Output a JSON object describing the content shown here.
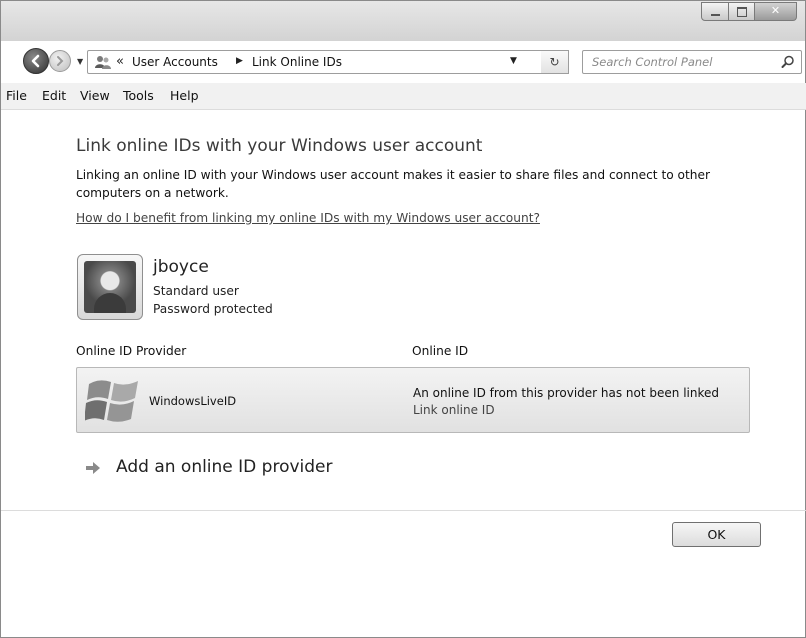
{
  "toolbar": {
    "breadcrumb": [
      "User Accounts",
      "Link Online IDs"
    ],
    "breadcrumb_prefix": "«",
    "search_placeholder": "Search Control Panel"
  },
  "menu": [
    "File",
    "Edit",
    "View",
    "Tools",
    "Help"
  ],
  "page": {
    "heading": "Link online IDs with your Windows user account",
    "description": "Linking an online ID with your Windows user account makes it easier to share files and connect to other computers on a network.",
    "help_link": "How do I benefit from linking my online IDs with my Windows user account?"
  },
  "user": {
    "name": "jboyce",
    "type": "Standard user",
    "protection": "Password protected"
  },
  "columns": {
    "provider": "Online ID Provider",
    "online_id": "Online ID"
  },
  "providers": [
    {
      "name": "WindowsLiveID",
      "status": "An online ID from this provider has not been linked",
      "action": "Link online ID"
    }
  ],
  "add_provider": "Add an online ID provider",
  "buttons": {
    "ok": "OK"
  },
  "colors": {
    "link": "#444444",
    "panel": "#e9e9e9"
  }
}
